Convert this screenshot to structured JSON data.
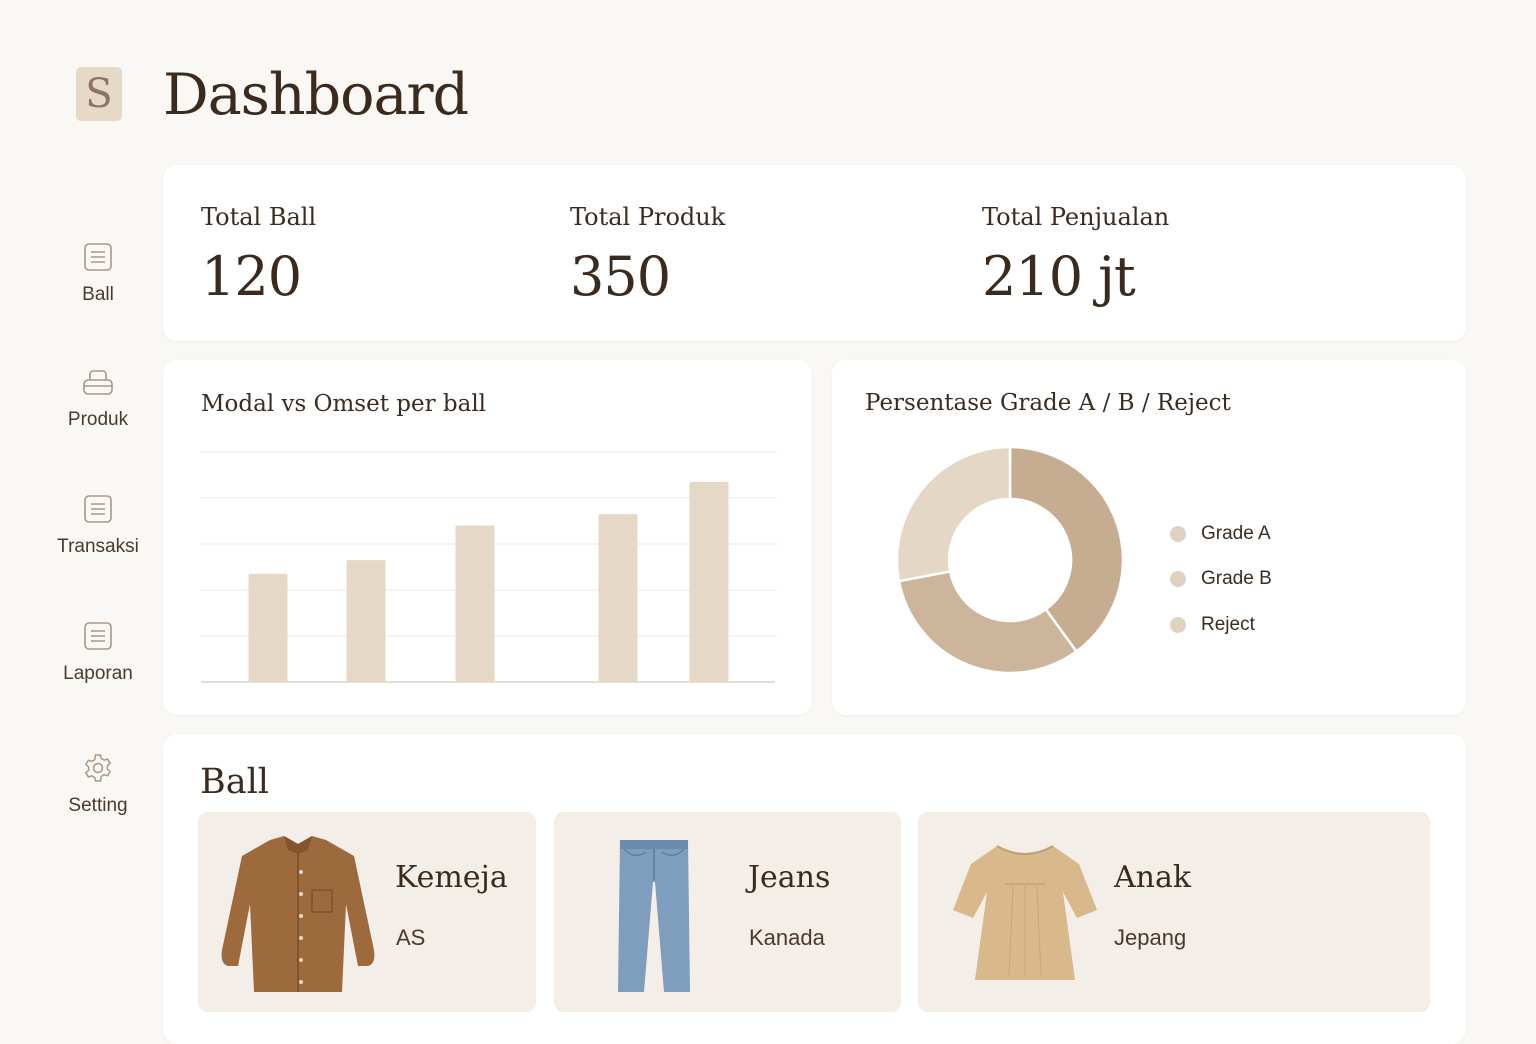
{
  "app": {
    "logo_letter": "S",
    "title": "Dashboard"
  },
  "sidebar": {
    "items": [
      {
        "label": "Ball",
        "icon": "document-icon"
      },
      {
        "label": "Produk",
        "icon": "printer-icon"
      },
      {
        "label": "Transaksi",
        "icon": "document-icon"
      },
      {
        "label": "Laporan",
        "icon": "document-icon"
      },
      {
        "label": "Setting",
        "icon": "gear-icon"
      }
    ]
  },
  "stats": [
    {
      "label": "Total Ball",
      "value": "120"
    },
    {
      "label": "Total Produk",
      "value": "350"
    },
    {
      "label": "Total Penjualan",
      "value": "210 jt"
    }
  ],
  "bar_card": {
    "title": "Modal vs Omset per ball"
  },
  "donut_card": {
    "title": "Persentase Grade A / B / Reject"
  },
  "chart_data": [
    {
      "type": "bar",
      "title": "Modal vs Omset per ball",
      "categories": [
        "",
        "",
        "",
        "",
        ""
      ],
      "values": [
        47,
        53,
        68,
        73,
        87
      ],
      "ylim": [
        0,
        100
      ],
      "grid": true,
      "color": "#e6d8c6"
    },
    {
      "type": "pie",
      "title": "Persentase Grade A / B / Reject",
      "labels": [
        "Grade A",
        "Grade B",
        "Reject"
      ],
      "values": [
        40,
        32,
        28
      ],
      "colors": [
        "#c6ad92",
        "#cdb59b",
        "#e5d7c6"
      ],
      "legend_dot_color": "#e0d2bf",
      "legend": "right"
    }
  ],
  "ball_section": {
    "title": "Ball",
    "items": [
      {
        "name": "Kemeja",
        "origin": "AS",
        "image": "shirt-icon"
      },
      {
        "name": "Jeans",
        "origin": "Kanada",
        "image": "jeans-icon"
      },
      {
        "name": "Anak",
        "origin": "Jepang",
        "image": "kids-dress-icon"
      }
    ]
  }
}
